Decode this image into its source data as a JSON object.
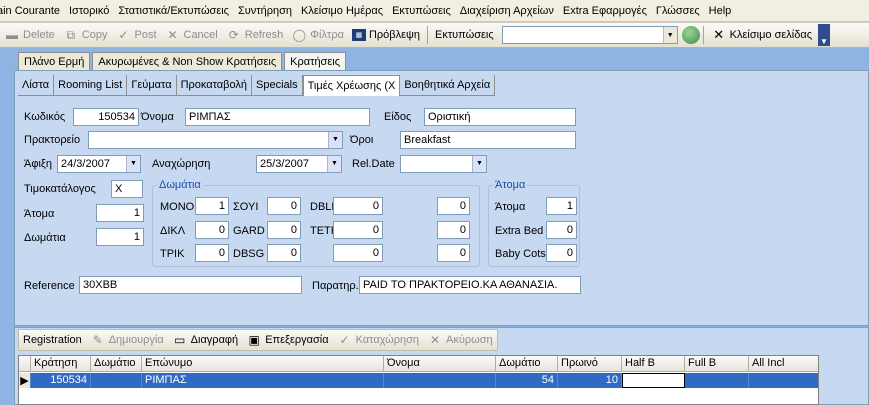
{
  "menubar": [
    "ain Courante",
    "Ιστορικό",
    "Στατιστικά/Εκτυπώσεις",
    "Συντήρηση",
    "Κλείσιμο Ημέρας",
    "Εκτυπώσεις",
    "Διαχείριση Αρχείων",
    "Extra Εφαρμογές",
    "Γλώσσες",
    "Help"
  ],
  "toolbar": {
    "delete": "Delete",
    "copy": "Copy",
    "post": "Post",
    "cancel": "Cancel",
    "refresh": "Refresh",
    "filter": "Φίλτρα",
    "preview": "Πρόβλεψη",
    "prints": "Εκτυπώσεις",
    "close_page": "Κλείσιμο σελίδας"
  },
  "tabs_top": [
    "Πλάνο Ερμή",
    "Ακυρωμένες & Non Show Κρατήσεις",
    "Κρατήσεις"
  ],
  "tabs_sub": [
    "Λίστα",
    "Rooming List",
    "Γεύματα",
    "Προκαταβολή",
    "Specials",
    "Τιμές Χρέωσης (Χ",
    "Βοηθητικά Αρχεία"
  ],
  "form": {
    "code_label": "Κωδικός",
    "code": "150534",
    "name_label": "Όνομα",
    "name": "ΡΙΜΠΑΣ",
    "kind_label": "Είδος",
    "kind": "Οριστική",
    "agency_label": "Πρακτορείο",
    "agency": "",
    "terms_label": "Όροι",
    "terms": "Breakfast",
    "arrival_label": "Άφιξη",
    "arrival": "24/3/2007",
    "departure_label": "Αναχώρηση",
    "departure": "25/3/2007",
    "reldate_label": "Rel.Date",
    "reldate": "",
    "pricelist_label": "Τιμοκατάλογος",
    "pricelist": "Χ",
    "persons_label": "Άτομα",
    "persons": "1",
    "rooms_label": "Δωμάτια",
    "rooms": "1",
    "reference_label": "Reference",
    "reference": "30ΧΒΒ",
    "remarks_label": "Παρατηρ.",
    "remarks": "PAID ΤΟ ΠΡΑΚΤΟΡΕΙΟ.ΚΑ ΑΘΑΝΑΣΙΑ."
  },
  "rooms_group": {
    "title": "Δωμάτια",
    "rows": [
      [
        {
          "label": "ΜΟΝΟ",
          "value": "1"
        },
        {
          "label": "ΣΟΥΙ",
          "value": "0"
        },
        {
          "label": "DBLE",
          "value": "0"
        },
        {
          "label": "",
          "value": "0"
        }
      ],
      [
        {
          "label": "ΔΙΚΛ",
          "value": "0"
        },
        {
          "label": "GARD",
          "value": "0"
        },
        {
          "label": "TETP",
          "value": "0"
        },
        {
          "label": "",
          "value": "0"
        }
      ],
      [
        {
          "label": "ΤΡΙΚ",
          "value": "0"
        },
        {
          "label": "DBSG",
          "value": "0"
        },
        {
          "label": "",
          "value": "0"
        },
        {
          "label": "",
          "value": "0"
        }
      ]
    ]
  },
  "persons_group": {
    "title": "Άτομα",
    "rows": [
      {
        "label": "Άτομα",
        "value": "1"
      },
      {
        "label": "Extra Bed",
        "value": "0"
      },
      {
        "label": "Baby Cots",
        "value": "0"
      }
    ]
  },
  "grid_toolbar": {
    "registration": "Registration",
    "create": "Δημιουργία",
    "delete": "Διαγραφή",
    "edit": "Επεξεργασία",
    "save": "Καταχώρηση",
    "cancel": "Ακύρωση"
  },
  "grid": {
    "columns": [
      "Κράτηση",
      "Δωμάτιο",
      "Επώνυμο",
      "Όνομα",
      "Δωμάτιο",
      "Πρωινό",
      "Half B",
      "Full B",
      "All Incl"
    ],
    "rows": [
      [
        "150534",
        "",
        "ΡΙΜΠΑΣ",
        "",
        "54",
        "10",
        "",
        "",
        ""
      ]
    ]
  }
}
